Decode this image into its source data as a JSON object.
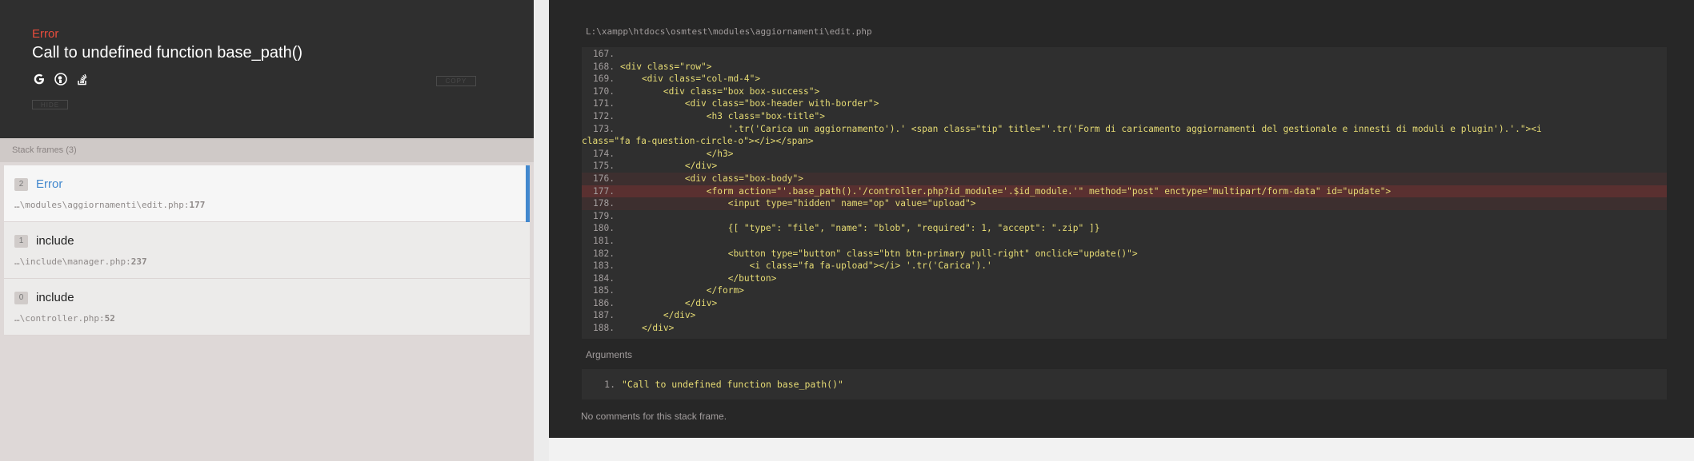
{
  "error": {
    "type": "Error",
    "message": "Call to undefined function base_path()"
  },
  "header_buttons": {
    "copy_label": "COPY",
    "hide_label": "HIDE"
  },
  "icons": [
    "google-icon",
    "duckduckgo-icon",
    "stackoverflow-icon"
  ],
  "stack": {
    "title": "Stack frames (3)",
    "frames": [
      {
        "index": "2",
        "class": "Error",
        "file": "…\\modules\\aggiornamenti\\edit.php",
        "line": "177"
      },
      {
        "index": "1",
        "class": "include",
        "file": "…\\include\\manager.php",
        "line": "237"
      },
      {
        "index": "0",
        "class": "include",
        "file": "…\\controller.php",
        "line": "52"
      }
    ]
  },
  "code": {
    "file_path": "L:\\xampp\\htdocs\\osmtest\\modules\\aggiornamenti\\edit.php",
    "lines": [
      {
        "n": "167.",
        "text": ""
      },
      {
        "n": "168.",
        "text": "<div class=\"row\">"
      },
      {
        "n": "169.",
        "text": "    <div class=\"col-md-4\">"
      },
      {
        "n": "170.",
        "text": "        <div class=\"box box-success\">"
      },
      {
        "n": "171.",
        "text": "            <div class=\"box-header with-border\">"
      },
      {
        "n": "172.",
        "text": "                <h3 class=\"box-title\">"
      },
      {
        "n": "173.",
        "text": "                    '.tr('Carica un aggiornamento').' <span class=\"tip\" title=\"'.tr('Form di caricamento aggiornamenti del gestionale e innesti di moduli e plugin').'.\"><i"
      },
      {
        "n": "",
        "text": "class=\"fa fa-question-circle-o\"></i></span>"
      },
      {
        "n": "174.",
        "text": "                </h3>"
      },
      {
        "n": "175.",
        "text": "            </div>"
      },
      {
        "n": "176.",
        "text": "            <div class=\"box-body\">"
      },
      {
        "n": "177.",
        "text": "                <form action=\"'.base_path().'/controller.php?id_module='.$id_module.'\" method=\"post\" enctype=\"multipart/form-data\" id=\"update\">"
      },
      {
        "n": "178.",
        "text": "                    <input type=\"hidden\" name=\"op\" value=\"upload\">"
      },
      {
        "n": "179.",
        "text": ""
      },
      {
        "n": "180.",
        "text": "                    {[ \"type\": \"file\", \"name\": \"blob\", \"required\": 1, \"accept\": \".zip\" ]}"
      },
      {
        "n": "181.",
        "text": ""
      },
      {
        "n": "182.",
        "text": "                    <button type=\"button\" class=\"btn btn-primary pull-right\" onclick=\"update()\">"
      },
      {
        "n": "183.",
        "text": "                        <i class=\"fa fa-upload\"></i> '.tr('Carica').'"
      },
      {
        "n": "184.",
        "text": "                    </button>"
      },
      {
        "n": "185.",
        "text": "                </form>"
      },
      {
        "n": "186.",
        "text": "            </div>"
      },
      {
        "n": "187.",
        "text": "        </div>"
      },
      {
        "n": "188.",
        "text": "    </div>"
      }
    ]
  },
  "arguments": {
    "title": "Arguments",
    "items": [
      {
        "n": "1.",
        "value": "\"Call to undefined function base_path()\""
      }
    ]
  },
  "comments": "No comments for this stack frame.",
  "colors": {
    "error_red": "#e74c3c",
    "accent_blue": "#4288ce",
    "code_yellow": "#e6db74",
    "header_bg": "#2f2f2f"
  }
}
